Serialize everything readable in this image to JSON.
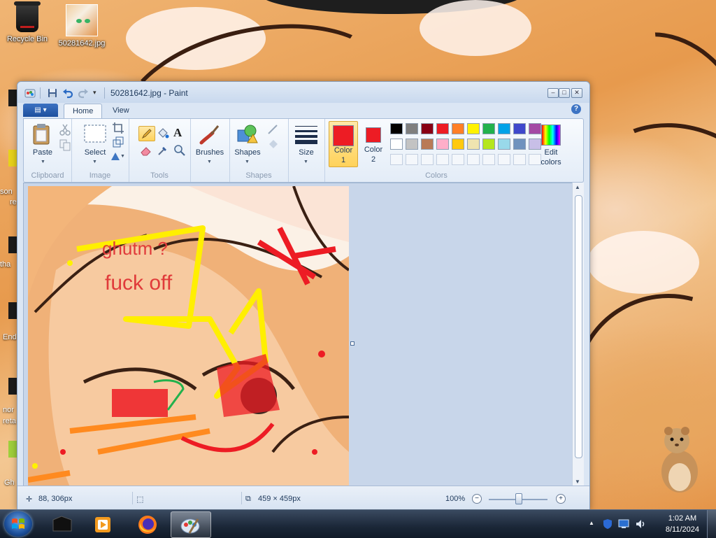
{
  "desktop": {
    "icons": [
      {
        "label": "Recycle Bin",
        "icon": "recycle-bin-icon"
      },
      {
        "label": "50281642.jpg",
        "icon": "image-file-icon"
      }
    ],
    "edge_labels": [
      "son",
      "re",
      "tha",
      "End",
      "nor",
      "reta",
      "Gh"
    ]
  },
  "paint": {
    "title": "50281642.jpg - Paint",
    "app_menu_icon": "paint-menu-icon",
    "tabs": [
      {
        "label": "Home",
        "active": true
      },
      {
        "label": "View",
        "active": false
      }
    ],
    "ribbon": {
      "clipboard": {
        "paste": "Paste",
        "group": "Clipboard"
      },
      "image": {
        "select": "Select",
        "group": "Image"
      },
      "tools": {
        "group": "Tools"
      },
      "brushes": {
        "label": "Brushes"
      },
      "shapes": {
        "label": "Shapes",
        "group": "Shapes"
      },
      "size": {
        "label": "Size"
      },
      "color1": {
        "label": "Color",
        "num": "1",
        "value": "#ed1c24"
      },
      "color2": {
        "label": "Color",
        "num": "2",
        "value": "#ed1c24"
      },
      "colors_group": "Colors",
      "edit_colors": {
        "line1": "Edit",
        "line2": "colors"
      },
      "palette_row1": [
        "#000000",
        "#7f7f7f",
        "#880015",
        "#ed1c24",
        "#ff7f27",
        "#fff200",
        "#22b14c",
        "#00a2e8",
        "#3f48cc",
        "#a349a4"
      ],
      "palette_row2": [
        "#ffffff",
        "#c3c3c3",
        "#b97a57",
        "#ffaec9",
        "#ffc90e",
        "#efe4b0",
        "#b5e61d",
        "#99d9ea",
        "#7092be",
        "#c8bfe7"
      ]
    },
    "canvas_text": [
      "ghutm ?",
      "fuck off"
    ],
    "status": {
      "cursor_pos": "88, 306px",
      "selection_size": "",
      "image_size": "459 × 459px",
      "zoom": "100%",
      "zoom_level": 1.0
    }
  },
  "taskbar": {
    "apps": [
      {
        "icon": "terminal-icon",
        "active": false
      },
      {
        "icon": "media-player-icon",
        "active": false
      },
      {
        "icon": "firefox-icon",
        "active": false
      },
      {
        "icon": "paint-icon",
        "active": true
      }
    ],
    "time": "1:02 AM",
    "date": "8/11/2024"
  }
}
